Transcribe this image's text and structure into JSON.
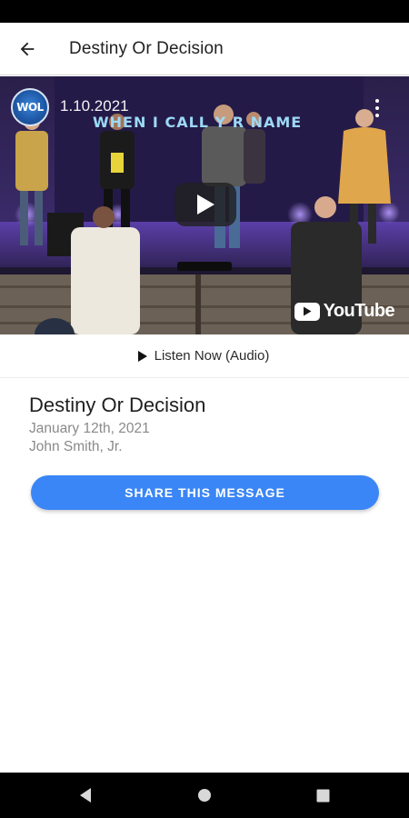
{
  "app_bar": {
    "title": "Destiny Or Decision",
    "back_icon": "arrow-left-icon"
  },
  "video": {
    "date_overlay": "1.10.2021",
    "lyric_overlay": "WHEN I CALL Y    R NAME",
    "channel_logo_text": "WOL",
    "platform_label": "YouTube",
    "play_icon": "play-icon",
    "more_icon": "more-vertical-icon"
  },
  "audio": {
    "label": "Listen Now (Audio)",
    "icon": "play-small-icon"
  },
  "message": {
    "title": "Destiny Or Decision",
    "date": "January 12th, 2021",
    "speaker": "John Smith, Jr."
  },
  "actions": {
    "share_label": "SHARE THIS MESSAGE"
  },
  "colors": {
    "accent": "#3b86f6",
    "secondary_text": "#8a8a8a"
  },
  "system_nav": {
    "back": "nav-back-icon",
    "home": "nav-home-icon",
    "recents": "nav-recents-icon"
  }
}
